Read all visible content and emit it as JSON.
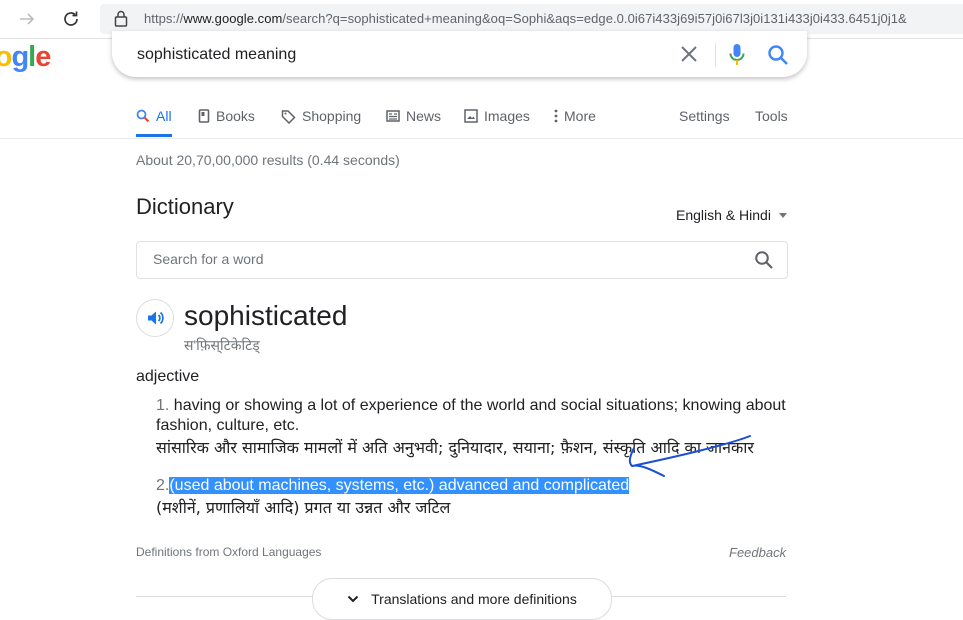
{
  "browser": {
    "url_prefix": "https://",
    "url_host": "www.google.com",
    "url_rest": "/search?q=sophisticated+meaning&oq=Sophi&aqs=edge.0.0i67i433j69i57j0i67l3j0i131i433j0i433.6451j0j1&"
  },
  "search": {
    "logo_letters": [
      "o",
      "o",
      "g",
      "l",
      "e"
    ],
    "logo_colors": [
      "#ea4335",
      "#fbbc05",
      "#4285f4",
      "#34a853",
      "#ea4335"
    ],
    "query": "sophisticated meaning"
  },
  "tabs": [
    {
      "label": "All",
      "icon": "search-icon"
    },
    {
      "label": "Books",
      "icon": "book-icon"
    },
    {
      "label": "Shopping",
      "icon": "tag-icon"
    },
    {
      "label": "News",
      "icon": "newspaper-icon"
    },
    {
      "label": "Images",
      "icon": "image-icon"
    },
    {
      "label": "More",
      "icon": "more-vert-icon"
    }
  ],
  "tools": {
    "settings": "Settings",
    "tools": "Tools"
  },
  "stats": "About 20,70,00,000 results (0.44 seconds)",
  "dictionary": {
    "title": "Dictionary",
    "language": "English & Hindi",
    "search_placeholder": "Search for a word",
    "word": "sophisticated",
    "phonetic": "स'फ़िस्‌टिकेटिड्",
    "part_of_speech": "adjective",
    "definitions": [
      {
        "number": "1.",
        "text": "having or showing a lot of experience of the world and social situations; knowing about fashion, culture, etc.",
        "hindi": "सांसारिक और सामाजिक मामलों में अति अनुभवी; दुनियादार, सयाना; फ़ैशन, संस्कृति आदि का जानकार"
      },
      {
        "number": "2.",
        "text": "(used about machines, systems, etc.) advanced and complicated",
        "hindi": "(मशीनें, प्रणालियाँ आदि) प्रगत या उन्नत और जटिल"
      }
    ],
    "source": "Definitions from Oxford Languages",
    "feedback": "Feedback",
    "more_button": "Translations and more definitions"
  },
  "colors": {
    "accent": "#1a73e8",
    "selection": "#3390ff",
    "annotation": "#1a4fd6"
  }
}
